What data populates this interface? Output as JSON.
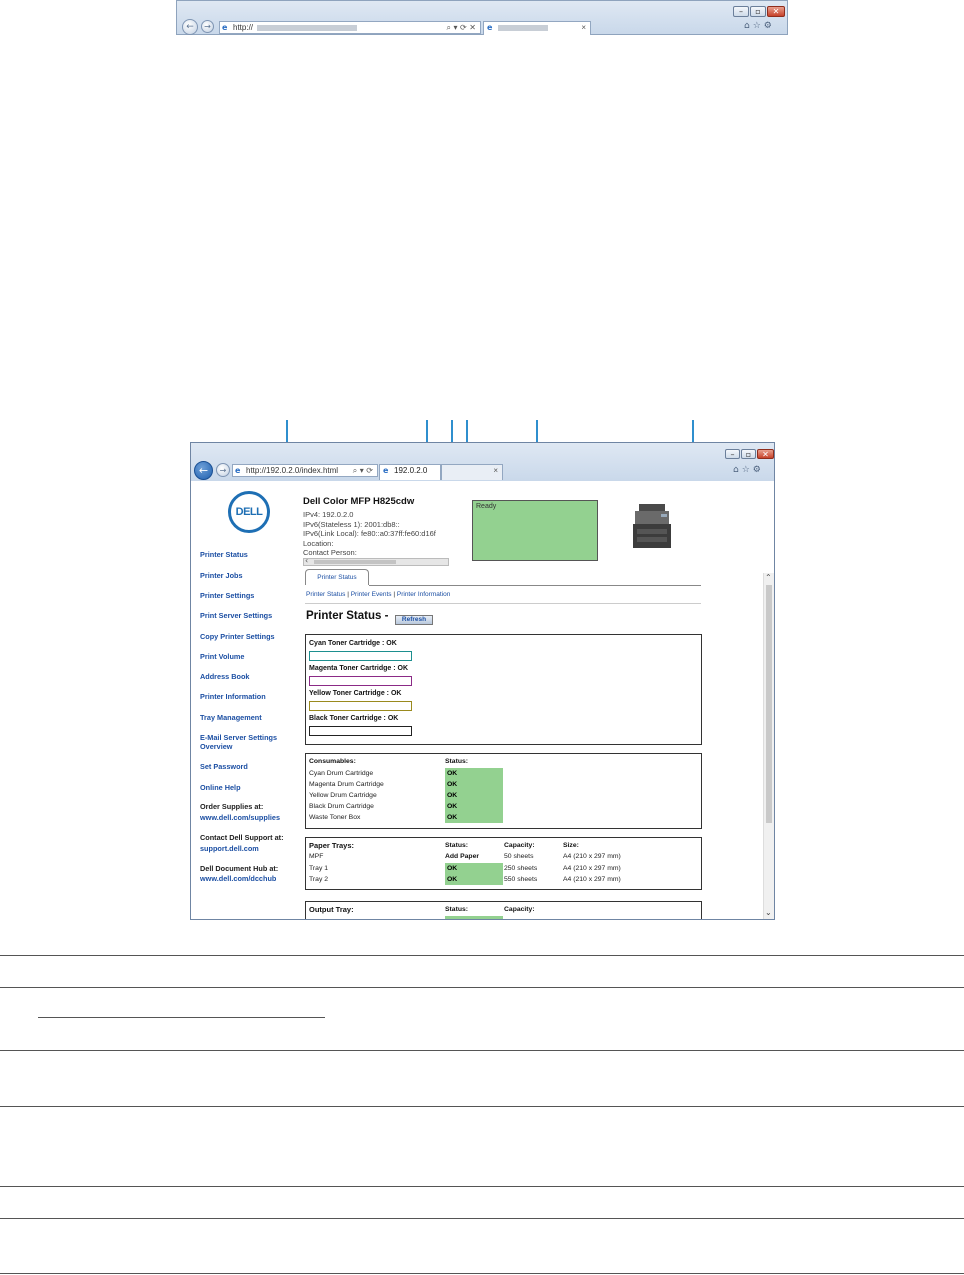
{
  "top_browser": {
    "address": "http://",
    "tab_title": "",
    "tab_close": "×",
    "window_controls": {
      "minimize": "–",
      "restore": "▫",
      "close": "✕"
    }
  },
  "browser": {
    "address": "http://192.0.2.0/index.html",
    "tab_title": "192.0.2.0",
    "tab_close": "×",
    "window_controls": {
      "minimize": "–",
      "restore": "▫",
      "close": "✕"
    }
  },
  "logo_text": "DELL",
  "sidebar": {
    "links": [
      "Printer Status",
      "Printer Jobs",
      "Printer Settings",
      "Print Server Settings",
      "Copy Printer Settings",
      "Print Volume",
      "Address Book",
      "Printer Information",
      "Tray Management",
      "E-Mail Server Settings",
      "Overview",
      "Set Password",
      "Online Help"
    ],
    "order_supplies_label": "Order Supplies at:",
    "order_supplies_link": "www.dell.com/supplies",
    "support_label": "Contact Dell Support at:",
    "support_link": "support.dell.com",
    "hub_label": "Dell Document Hub at:",
    "hub_link": "www.dell.com/dcchub"
  },
  "header": {
    "title": "Dell Color MFP H825cdw",
    "ipv4": "IPv4: 192.0.2.0",
    "ipv6_stateless": "IPv6(Stateless 1): 2001:db8::",
    "ipv6_link_local": "IPv6(Link Local): fe80::a0:37ff:fe60:d16f",
    "location": "Location:",
    "contact_person": "Contact Person:",
    "status_text": "Ready"
  },
  "tabs": {
    "active": "Printer Status"
  },
  "sublinks": [
    "Printer Status",
    "Printer Events",
    "Printer Information"
  ],
  "sublink_sep": "|",
  "main": {
    "title": "Printer Status -",
    "refresh": "Refresh",
    "toner": [
      {
        "label": "Cyan Toner Cartridge : OK",
        "color": "#1d8f8f"
      },
      {
        "label": "Magenta Toner Cartridge : OK",
        "color": "#8b2a86"
      },
      {
        "label": "Yellow Toner Cartridge : OK",
        "color": "#9a8a1e"
      },
      {
        "label": "Black Toner Cartridge : OK",
        "color": "#222222"
      }
    ],
    "consumables": {
      "headers": [
        "Consumables:",
        "Status:"
      ],
      "rows": [
        [
          "Cyan Drum Cartridge",
          "OK"
        ],
        [
          "Magenta Drum Cartridge",
          "OK"
        ],
        [
          "Yellow Drum Cartridge",
          "OK"
        ],
        [
          "Black Drum Cartridge",
          "OK"
        ],
        [
          "Waste Toner Box",
          "OK"
        ]
      ]
    },
    "paper_trays": {
      "headers": [
        "Paper Trays:",
        "Status:",
        "Capacity:",
        "Size:"
      ],
      "rows": [
        [
          "MPF",
          "Add Paper",
          "50 sheets",
          "A4 (210 x 297 mm)"
        ],
        [
          "Tray 1",
          "OK",
          "250 sheets",
          "A4 (210 x 297 mm)"
        ],
        [
          "Tray 2",
          "OK",
          "550 sheets",
          "A4 (210 x 297 mm)"
        ]
      ]
    },
    "output_tray": {
      "headers": [
        "Output Tray:",
        "Status:",
        "Capacity:"
      ]
    }
  },
  "colors": {
    "ok_green": "#93d190",
    "link_blue": "#1c4fa3",
    "callout_blue": "#2f8fce"
  }
}
